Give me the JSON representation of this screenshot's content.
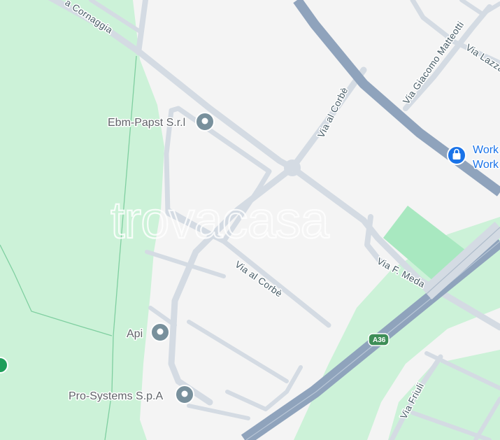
{
  "map": {
    "watermark": "trovacasa",
    "streets": {
      "via_cornaggia": "a Cornaggia",
      "via_giacomo_matteotti": "Via Giacomo Matteotti",
      "via_lazzaro": "Via Lazza",
      "via_al_corbe_north": "Via al Corbè",
      "via_al_corbe_south": "Via al Corbè",
      "via_f_meda": "Via F. Meda",
      "via_friuli": "Via Friuli"
    },
    "motorway_shield": "A36",
    "pois": {
      "ebm_papst": "Ebm-Papst S.r.l",
      "api": "Api",
      "pro_systems": "Pro-Systems S.p.A",
      "work_line1": "Work",
      "work_line2": "Work"
    },
    "icons": {
      "poi": "map-pin-icon",
      "work": "shopping-bag-icon",
      "park": "park-marker-icon"
    },
    "colors": {
      "background": "#f4f4f4",
      "park": "#ccf2d8",
      "park_dark": "#a8e8c0",
      "road": "#d4dbe3",
      "motorway": "#8fa3bc",
      "poi_pin": "#78909c",
      "work_pin": "#1a73e8",
      "park_marker": "#1e9e5a"
    }
  }
}
